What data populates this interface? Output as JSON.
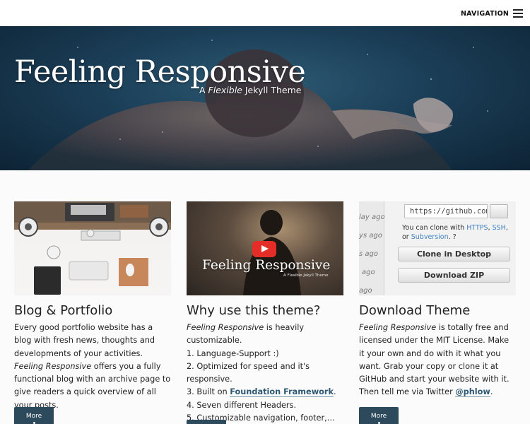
{
  "nav": {
    "label": "NAVIGATION"
  },
  "hero": {
    "title": "Feeling Responsive",
    "subtitle_pre": "A ",
    "subtitle_em": "Flexible",
    "subtitle_post": " Jekyll Theme"
  },
  "columns": [
    {
      "heading": "Blog & Portfolio",
      "text_a": "Every good portfolio website has a blog with fresh news, thoughts and developments of your activities. ",
      "text_em": "Feeling Responsive",
      "text_b": " offers you a fully functional blog with an archive page to give readers a quick overview of all your posts.",
      "button": "More"
    },
    {
      "heading": "Why use this theme?",
      "intro_em": "Feeling Responsive",
      "intro_rest": " is heavily customizable.",
      "item1": "1. Language-Support :)",
      "item2": "2. Optimized for speed and it's responsive.",
      "item3_pre": "3. Built on ",
      "item3_link": "Foundation Framework",
      "item3_post": ".",
      "item4": "4. Seven different Headers.",
      "item5": "5. Customizable navigation, footer,...",
      "video_title": "Feeling Responsive",
      "video_sub": "A Flexible Jekyll Theme"
    },
    {
      "heading": "Download Theme",
      "text_em": "Feeling Responsive",
      "text_a": " is totally free and licensed under the MIT License. Make it your own and do with it what you want. Grab your copy or clone it at GitHub and start your website with it. Then tell me via Twitter ",
      "text_link": "@phlow",
      "text_b": ".",
      "button": "More",
      "gh_url": "https://github.com",
      "gh_clone_pre": "You can clone with ",
      "gh_https": "HTTPS",
      "gh_sep1": ", ",
      "gh_ssh": "SSH",
      "gh_sep2": ", or ",
      "gh_svn": "Subversion",
      "gh_clone_post": ". ?",
      "gh_clone_btn": "Clone in Desktop",
      "gh_zip_btn": "Download ZIP",
      "gh_ago": [
        "lay ago",
        "ys ago",
        "s ago",
        "ago",
        "ago"
      ]
    }
  ],
  "colors": {
    "accent": "#2c4a5c",
    "link": "#2f5973"
  }
}
